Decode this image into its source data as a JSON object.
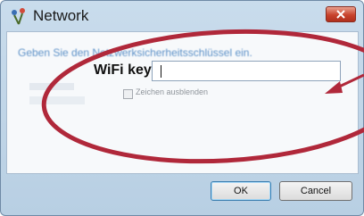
{
  "dialog": {
    "title": "Network",
    "instruction": "Geben Sie den Netzwerksicherheitsschlüssel ein.",
    "field_label": "WiFi key:",
    "key_value": "",
    "checkbox_label": "Zeichen ausblenden",
    "checkbox_checked": false,
    "ok_label": "OK",
    "cancel_label": "Cancel"
  },
  "icons": {
    "title": "network-icon",
    "close": "close-icon"
  },
  "colors": {
    "frame": "#c9dcec",
    "close_button": "#c8432c",
    "instruction_text": "#2a6fb7",
    "annotation": "#b0283a"
  }
}
